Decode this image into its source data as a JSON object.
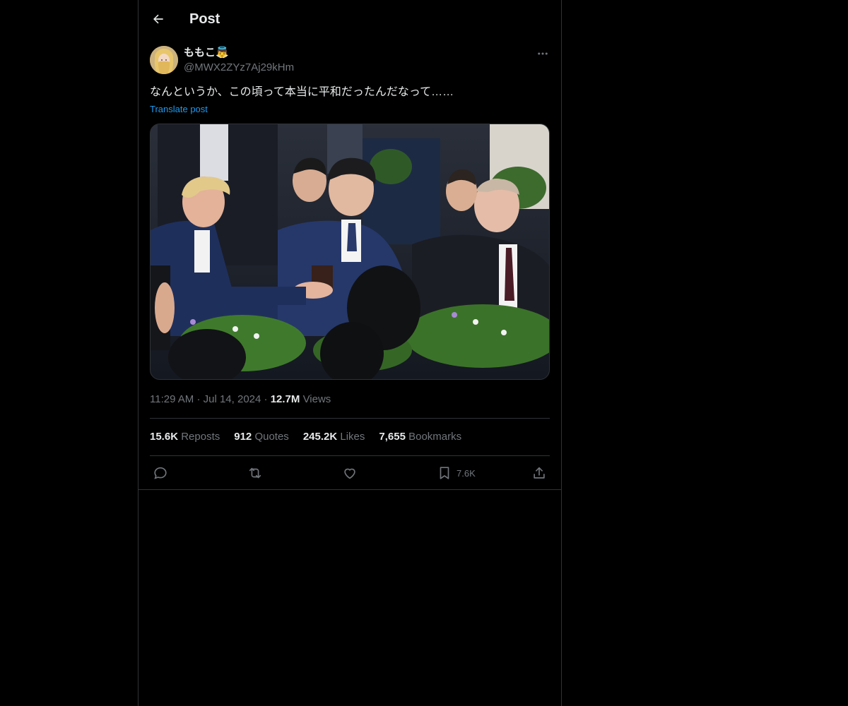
{
  "header": {
    "title": "Post",
    "back_icon": "arrow-left-icon"
  },
  "post": {
    "display_name": "ももこ👼",
    "handle": "@MWX2ZYz7Aj29kHm",
    "text": "なんというか、この頃って本当に平和だったんだなって……",
    "translate_label": "Translate post",
    "media_icon": "photo-image",
    "time": "11:29 AM",
    "date": "Jul 14, 2024",
    "views_count": "12.7M",
    "views_label": "Views"
  },
  "stats": {
    "reposts_count": "15.6K",
    "reposts_label": "Reposts",
    "quotes_count": "912",
    "quotes_label": "Quotes",
    "likes_count": "245.2K",
    "likes_label": "Likes",
    "bookmarks_count": "7,655",
    "bookmarks_label": "Bookmarks"
  },
  "actions": {
    "reply_icon": "reply-icon",
    "repost_icon": "repost-icon",
    "like_icon": "heart-icon",
    "bookmark_icon": "bookmark-icon",
    "bookmark_count": "7.6K",
    "share_icon": "share-icon"
  },
  "colors": {
    "background": "#000000",
    "text": "#e7e9ea",
    "secondary": "#71767b",
    "accent": "#1d9bf0",
    "border": "#2f3336"
  }
}
